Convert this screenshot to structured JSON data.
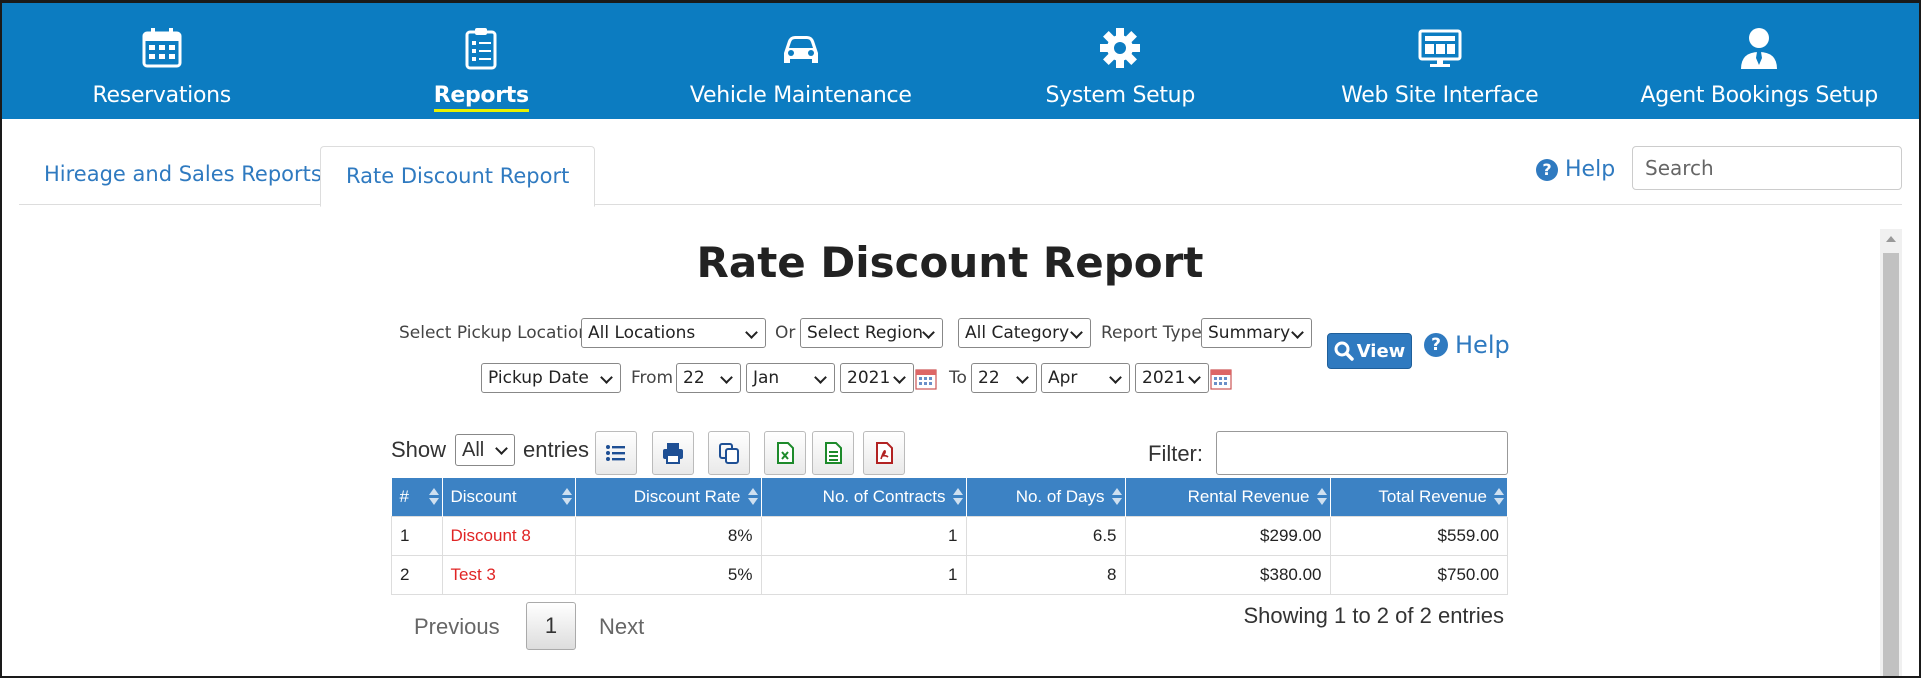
{
  "nav": {
    "items": [
      {
        "label": "Reservations",
        "icon": "calendar-icon"
      },
      {
        "label": "Reports",
        "icon": "clipboard-icon",
        "active": true
      },
      {
        "label": "Vehicle Maintenance",
        "icon": "car-icon"
      },
      {
        "label": "System Setup",
        "icon": "gear-icon"
      },
      {
        "label": "Web Site Interface",
        "icon": "monitor-icon"
      },
      {
        "label": "Agent Bookings Setup",
        "icon": "agent-icon"
      }
    ],
    "accent": "#0c7cc1"
  },
  "tabs": [
    {
      "label": "Hireage and Sales Reports"
    },
    {
      "label": "Rate Discount Report",
      "active": true
    }
  ],
  "header": {
    "help_label": "Help",
    "search_placeholder": "Search"
  },
  "report": {
    "title": "Rate Discount Report",
    "filters": {
      "pickup_location_label": "Select Pickup Location",
      "pickup_location_value": "All Locations",
      "or_label": "Or",
      "region_value": "Select Region",
      "category_value": "All Category",
      "report_type_label": "Report Type",
      "report_type_value": "Summary",
      "date_type_value": "Pickup Date",
      "from_label": "From",
      "from_day": "22",
      "from_month": "Jan",
      "from_year": "2021",
      "to_label": "To",
      "to_day": "22",
      "to_month": "Apr",
      "to_year": "2021"
    },
    "view_label": "View",
    "help_label": "Help"
  },
  "datatable": {
    "show_label": "Show",
    "length_value": "All",
    "entries_label": "entries",
    "filter_label": "Filter:",
    "columns": [
      "#",
      "Discount",
      "Discount Rate",
      "No. of Contracts",
      "No. of Days",
      "Rental Revenue",
      "Total Revenue"
    ],
    "rows": [
      {
        "num": "1",
        "discount": "Discount 8",
        "rate": "8%",
        "contracts": "1",
        "days": "6.5",
        "rental": "$299.00",
        "total": "$559.00"
      },
      {
        "num": "2",
        "discount": "Test 3",
        "rate": "5%",
        "contracts": "1",
        "days": "8",
        "rental": "$380.00",
        "total": "$750.00"
      }
    ],
    "pager": {
      "previous": "Previous",
      "current": "1",
      "next": "Next"
    },
    "info": "Showing 1 to 2 of 2 entries"
  }
}
